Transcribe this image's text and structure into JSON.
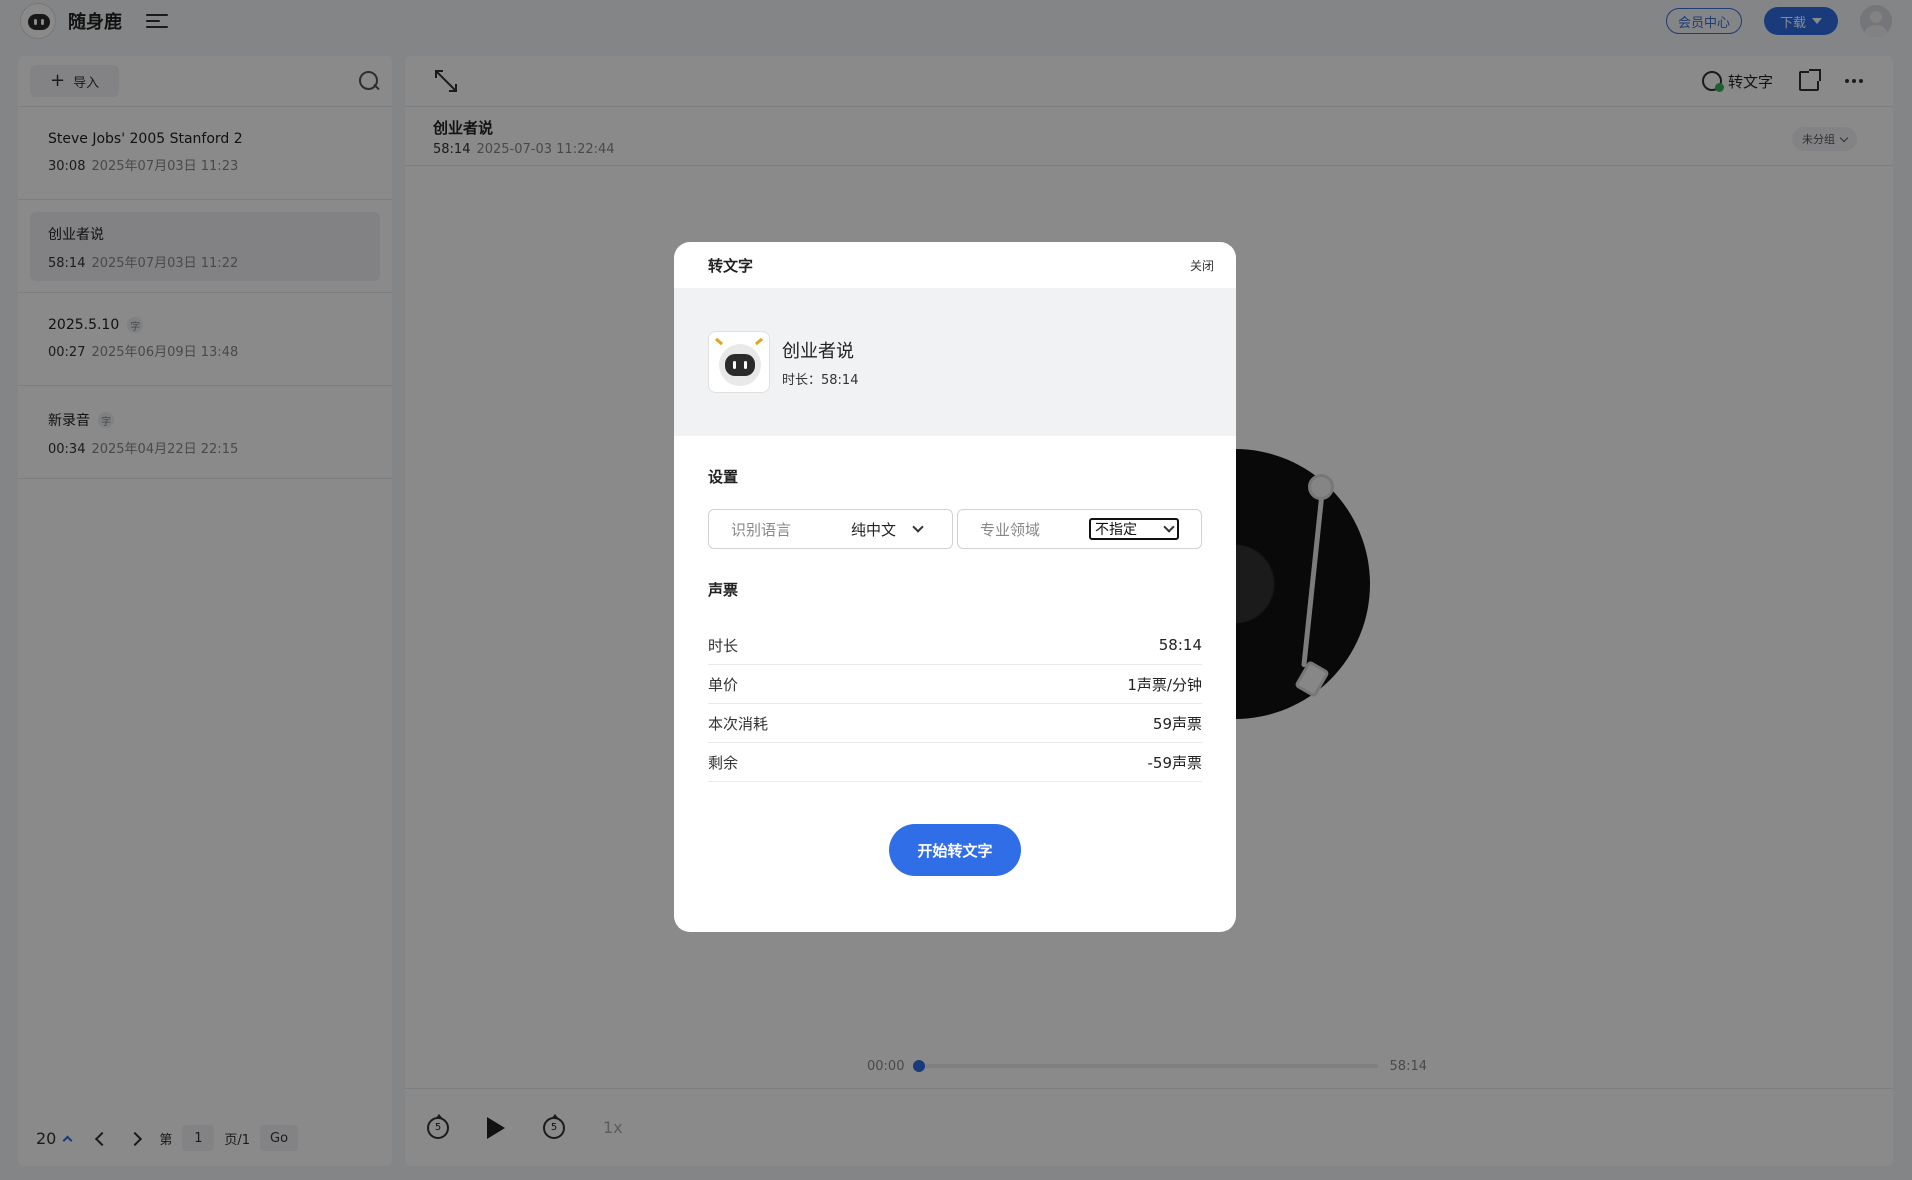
{
  "app": {
    "name": "随身鹿"
  },
  "topbar": {
    "member_center": "会员中心",
    "download": "下载"
  },
  "sidebar": {
    "import_label": "导入",
    "items": [
      {
        "title": "Steve Jobs' 2005 Stanford 2",
        "duration": "30:08",
        "date": "2025年07月03日 11:23",
        "badge": ""
      },
      {
        "title": "创业者说",
        "duration": "58:14",
        "date": "2025年07月03日 11:22",
        "badge": ""
      },
      {
        "title": "2025.5.10",
        "duration": "00:27",
        "date": "2025年06月09日 13:48",
        "badge": "字"
      },
      {
        "title": "新录音",
        "duration": "00:34",
        "date": "2025年04月22日 22:15",
        "badge": "字"
      }
    ],
    "pager": {
      "page_size": "20",
      "page_prefix": "第",
      "page_number": "1",
      "page_suffix": "页/1",
      "go": "Go"
    }
  },
  "main": {
    "toolbar": {
      "transcribe": "转文字"
    },
    "title": "创业者说",
    "duration": "58:14",
    "datetime": "2025-07-03 11:22:44",
    "group": "未分组",
    "player": {
      "current": "00:00",
      "total": "58:14",
      "speed": "1x",
      "rewind_seconds": "5",
      "forward_seconds": "5",
      "progress": 0
    }
  },
  "modal": {
    "title": "转文字",
    "close": "关闭",
    "file": {
      "name": "创业者说",
      "duration_label": "时长：58:14"
    },
    "settings": {
      "title": "设置",
      "language_label": "识别语言",
      "language_value": "纯中文",
      "domain_label": "专业领域",
      "domain_value": "不指定"
    },
    "tickets": {
      "title": "声票",
      "rows": [
        {
          "label": "时长",
          "value": "58:14"
        },
        {
          "label": "单价",
          "value": "1声票/分钟"
        },
        {
          "label": "本次消耗",
          "value": "59声票"
        },
        {
          "label": "剩余",
          "value": "-59声票"
        }
      ]
    },
    "start_button": "开始转文字"
  },
  "colors": {
    "accent": "#2f6ee6"
  }
}
